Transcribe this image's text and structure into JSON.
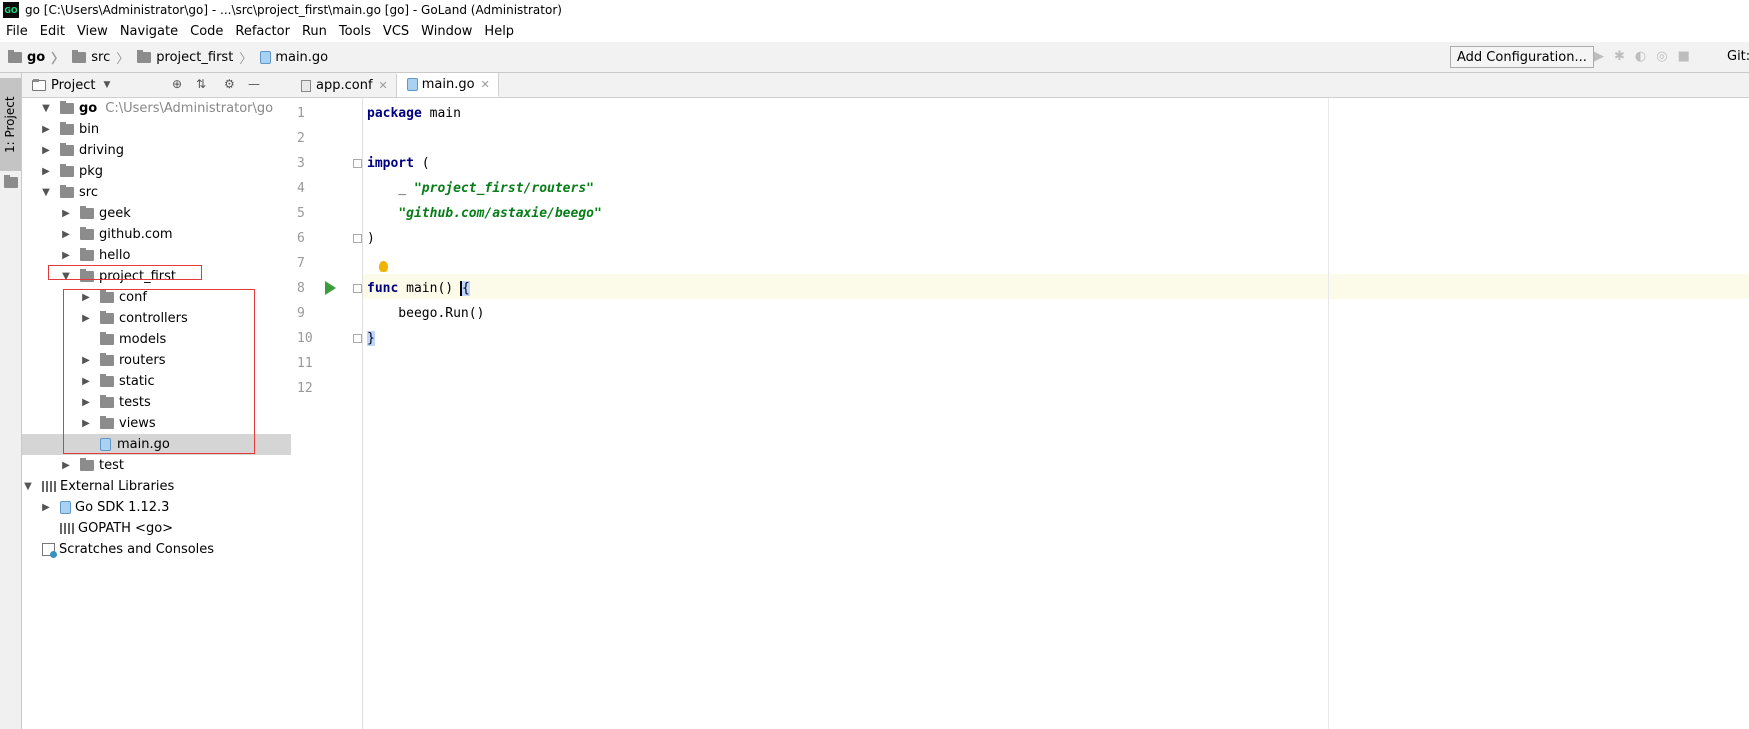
{
  "window": {
    "title": "go [C:\\Users\\Administrator\\go] - ...\\src\\project_first\\main.go [go] - GoLand (Administrator)",
    "app_icon": "GO"
  },
  "menu": [
    "File",
    "Edit",
    "View",
    "Navigate",
    "Code",
    "Refactor",
    "Run",
    "Tools",
    "VCS",
    "Window",
    "Help"
  ],
  "breadcrumb": [
    "go",
    "src",
    "project_first",
    "main.go"
  ],
  "toolbar": {
    "add_configuration": "Add Configuration...",
    "git": "Git:"
  },
  "side_tab": "1: Project",
  "project_panel": {
    "title": "Project"
  },
  "tree": [
    {
      "label": "go",
      "extra": "C:\\Users\\Administrator\\go"
    },
    {
      "label": "bin"
    },
    {
      "label": "driving"
    },
    {
      "label": "pkg"
    },
    {
      "label": "src"
    },
    {
      "label": "geek"
    },
    {
      "label": "github.com"
    },
    {
      "label": "hello"
    },
    {
      "label": "project_first"
    },
    {
      "label": "conf"
    },
    {
      "label": "controllers"
    },
    {
      "label": "models"
    },
    {
      "label": "routers"
    },
    {
      "label": "static"
    },
    {
      "label": "tests"
    },
    {
      "label": "views"
    },
    {
      "label": "main.go"
    },
    {
      "label": "test"
    },
    {
      "label": "External Libraries"
    },
    {
      "label": "Go SDK 1.12.3"
    },
    {
      "label": "GOPATH <go>"
    },
    {
      "label": "Scratches and Consoles"
    }
  ],
  "tabs": [
    {
      "label": "app.conf",
      "active": false
    },
    {
      "label": "main.go",
      "active": true
    }
  ],
  "editor": {
    "line_numbers": [
      "1",
      "2",
      "3",
      "4",
      "5",
      "6",
      "7",
      "8",
      "9",
      "10",
      "11",
      "12"
    ],
    "code": {
      "l1_kw": "package",
      "l1_rest": " main",
      "l3_kw": "import",
      "l3_rest": " (",
      "l4_prefix": "    _ ",
      "l4_str": "\"project_first/routers\"",
      "l5_prefix": "    ",
      "l5_str": "\"github.com/astaxie/beego\"",
      "l6": ")",
      "l8_kw": "func",
      "l8_rest": " main() ",
      "l8_brace": "{",
      "l9": "    beego.Run()",
      "l10_brace": "}"
    }
  }
}
